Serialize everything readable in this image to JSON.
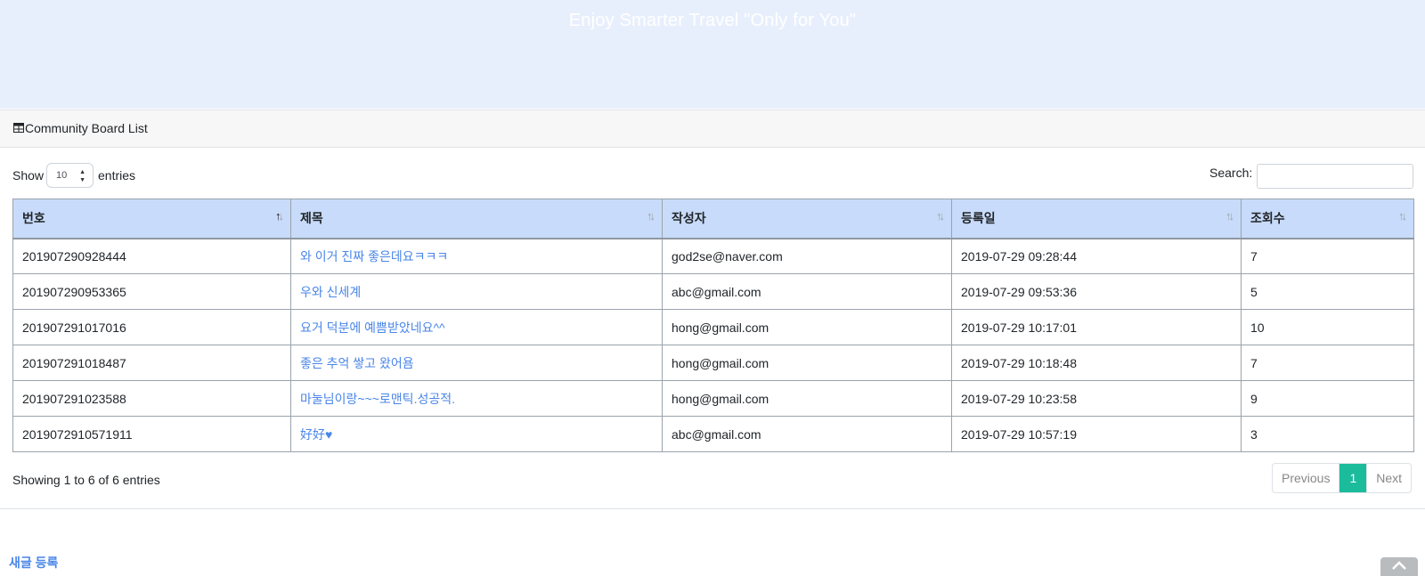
{
  "hero": {
    "title": "Enjoy Smarter Travel \"Only for You\""
  },
  "card": {
    "header_title": "Community Board List",
    "header_icon": "table-icon"
  },
  "length_menu": {
    "prefix": "Show",
    "value": "10",
    "suffix": "entries"
  },
  "search": {
    "label": "Search:",
    "value": ""
  },
  "table": {
    "columns": [
      "번호",
      "제목",
      "작성자",
      "등록일",
      "조회수"
    ],
    "rows": [
      [
        "201907290928444",
        "와 이거 진짜 좋은데요ㅋㅋㅋ",
        "god2se@naver.com",
        "2019-07-29 09:28:44",
        "7"
      ],
      [
        "201907290953365",
        "우와 신세계",
        "abc@gmail.com",
        "2019-07-29 09:53:36",
        "5"
      ],
      [
        "201907291017016",
        "요거 덕분에 예쁨받았네요^^",
        "hong@gmail.com",
        "2019-07-29 10:17:01",
        "10"
      ],
      [
        "201907291018487",
        "좋은 추억 쌓고 왔어욤",
        "hong@gmail.com",
        "2019-07-29 10:18:48",
        "7"
      ],
      [
        "201907291023588",
        "마눌님이랑~~~로맨틱.성공적.",
        "hong@gmail.com",
        "2019-07-29 10:23:58",
        "9"
      ],
      [
        "2019072910571911",
        "好好♥",
        "abc@gmail.com",
        "2019-07-29 10:57:19",
        "3"
      ]
    ]
  },
  "info": "Showing 1 to 6 of 6 entries",
  "pagination": {
    "previous": "Previous",
    "current": "1",
    "next": "Next"
  },
  "footer": {
    "new_post": "새글 등록"
  },
  "colors": {
    "hero_bg": "#e8effc",
    "header_row_bg": "#c8dbfa",
    "link": "#4a86e8",
    "active_page": "#1abc9c"
  }
}
